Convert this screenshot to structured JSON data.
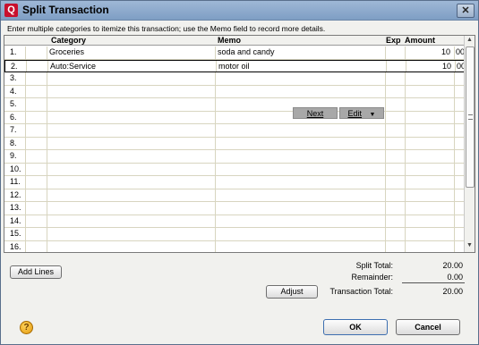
{
  "window": {
    "title": "Split Transaction",
    "app_icon_letter": "Q",
    "close_glyph": "✕"
  },
  "instructions": "Enter multiple categories to itemize this transaction; use the Memo field to record more details.",
  "columns": {
    "category": "Category",
    "memo": "Memo",
    "exp": "Exp",
    "amount": "Amount"
  },
  "rows": [
    {
      "num": "1.",
      "category": "Groceries",
      "memo": "soda and candy",
      "amount": "10",
      "cents": "00"
    },
    {
      "num": "2.",
      "category": "Auto:Service",
      "memo": "motor oil",
      "amount": "10",
      "cents": "00"
    },
    {
      "num": "3.",
      "category": "",
      "memo": "",
      "amount": "",
      "cents": ""
    },
    {
      "num": "4.",
      "category": "",
      "memo": "",
      "amount": "",
      "cents": ""
    },
    {
      "num": "5.",
      "category": "",
      "memo": "",
      "amount": "",
      "cents": ""
    },
    {
      "num": "6.",
      "category": "",
      "memo": "",
      "amount": "",
      "cents": ""
    },
    {
      "num": "7.",
      "category": "",
      "memo": "",
      "amount": "",
      "cents": ""
    },
    {
      "num": "8.",
      "category": "",
      "memo": "",
      "amount": "",
      "cents": ""
    },
    {
      "num": "9.",
      "category": "",
      "memo": "",
      "amount": "",
      "cents": ""
    },
    {
      "num": "10.",
      "category": "",
      "memo": "",
      "amount": "",
      "cents": ""
    },
    {
      "num": "11.",
      "category": "",
      "memo": "",
      "amount": "",
      "cents": ""
    },
    {
      "num": "12.",
      "category": "",
      "memo": "",
      "amount": "",
      "cents": ""
    },
    {
      "num": "13.",
      "category": "",
      "memo": "",
      "amount": "",
      "cents": ""
    },
    {
      "num": "14.",
      "category": "",
      "memo": "",
      "amount": "",
      "cents": ""
    },
    {
      "num": "15.",
      "category": "",
      "memo": "",
      "amount": "",
      "cents": ""
    },
    {
      "num": "16.",
      "category": "",
      "memo": "",
      "amount": "",
      "cents": ""
    }
  ],
  "row_actions": {
    "next": "Next",
    "edit": "Edit",
    "edit_arrow": "▼"
  },
  "buttons": {
    "add_lines": "Add Lines",
    "adjust": "Adjust",
    "ok": "OK",
    "cancel": "Cancel"
  },
  "totals": {
    "split_total_label": "Split Total:",
    "split_total": "20.00",
    "remainder_label": "Remainder:",
    "remainder": "0.00",
    "transaction_total_label": "Transaction Total:",
    "transaction_total": "20.00"
  },
  "help_glyph": "?",
  "colors": {
    "title_bar": "#8aa8cc",
    "app_icon": "#c8102e",
    "grid_line": "#d8d5c0",
    "row_button": "#a8a8a8"
  }
}
